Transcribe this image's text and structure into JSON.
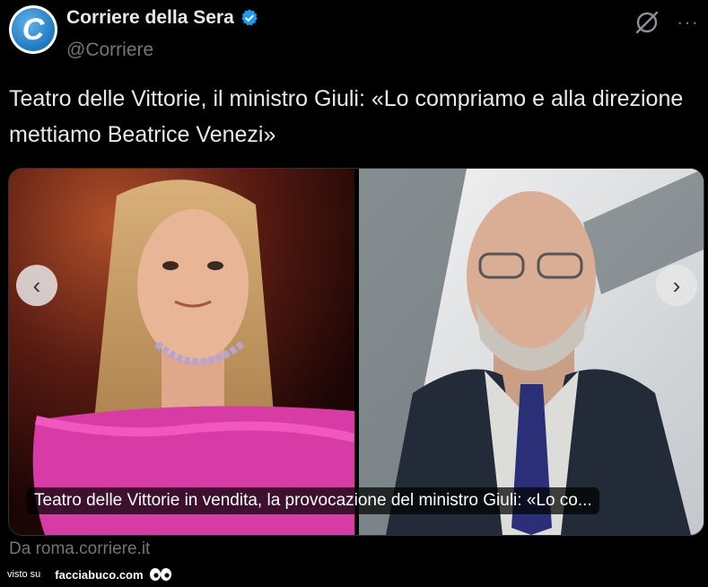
{
  "post": {
    "display_name": "Corriere della Sera",
    "handle": "@Corriere",
    "avatar_letter": "C",
    "text": "Teatro delle Vittorie, il ministro Giuli: «Lo compriamo e alla direzione mettiamo Beatrice Venezi»"
  },
  "media": {
    "caption": "Teatro delle Vittorie in vendita, la provocazione del ministro Giuli: «Lo co...",
    "prev_arrow": "‹",
    "next_arrow": "›",
    "source": "Da roma.corriere.it"
  },
  "header_icons": {
    "more": "···"
  },
  "watermark": {
    "prefix": "visto su",
    "brand": "facciabuco.com"
  },
  "colors": {
    "background": "#000000",
    "text_primary": "#e7e9ea",
    "text_secondary": "#71767b",
    "verified": "#1d9bf0",
    "avatar_blue": "#1f77bf"
  }
}
